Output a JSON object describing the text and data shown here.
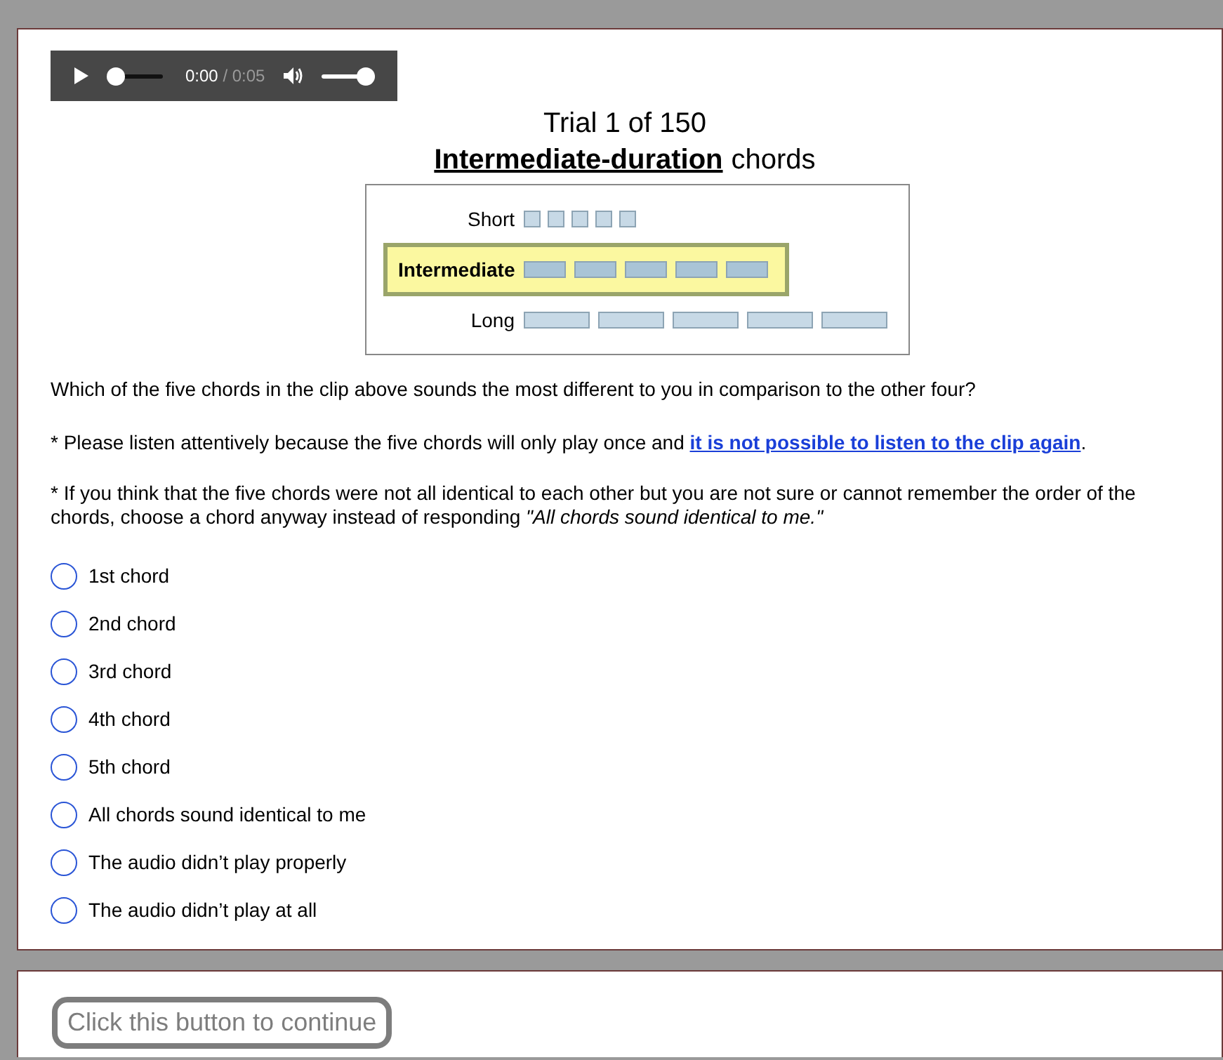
{
  "audio_player": {
    "time": "0:00",
    "duration": "/ 0:05",
    "volume": {
      "level": 1
    }
  },
  "heading": {
    "title": "Trial 1 of 150",
    "emphasis": "Intermediate-duration",
    "rest": "chords"
  },
  "duration_diagram": {
    "rows": [
      {
        "label": "Short",
        "kind": "short",
        "selected": false
      },
      {
        "label": "Intermediate",
        "kind": "intermediate",
        "selected": true
      },
      {
        "label": "Long",
        "kind": "long",
        "selected": false
      }
    ]
  },
  "question": "Which of the five chords in the clip above sounds the most different to you in comparison to the other four?",
  "note_1": {
    "text": "* Please listen attentively because the five chords will only play once and ",
    "link": "it is not possible to listen to the clip again",
    "after": "."
  },
  "note_2": "* If you think that the five chords were not all identical to each other but you are not sure or cannot remember the order of the chords, choose a chord anyway instead of responding *\"All chords sound identical to me.\"*",
  "options": [
    {
      "label": "1st chord",
      "selected": false
    },
    {
      "label": "2nd chord",
      "selected": false
    },
    {
      "label": "3rd chord",
      "selected": false
    },
    {
      "label": "4th chord",
      "selected": false
    },
    {
      "label": "5th chord",
      "selected": false
    },
    {
      "label": "All chords sound identical to me",
      "selected": false
    },
    {
      "label": "The audio didn’t play properly",
      "selected": false
    },
    {
      "label": "The audio didn’t play at all",
      "selected": false
    }
  ],
  "continue_button": {
    "label": "Click this button to continue",
    "disabled": true
  }
}
